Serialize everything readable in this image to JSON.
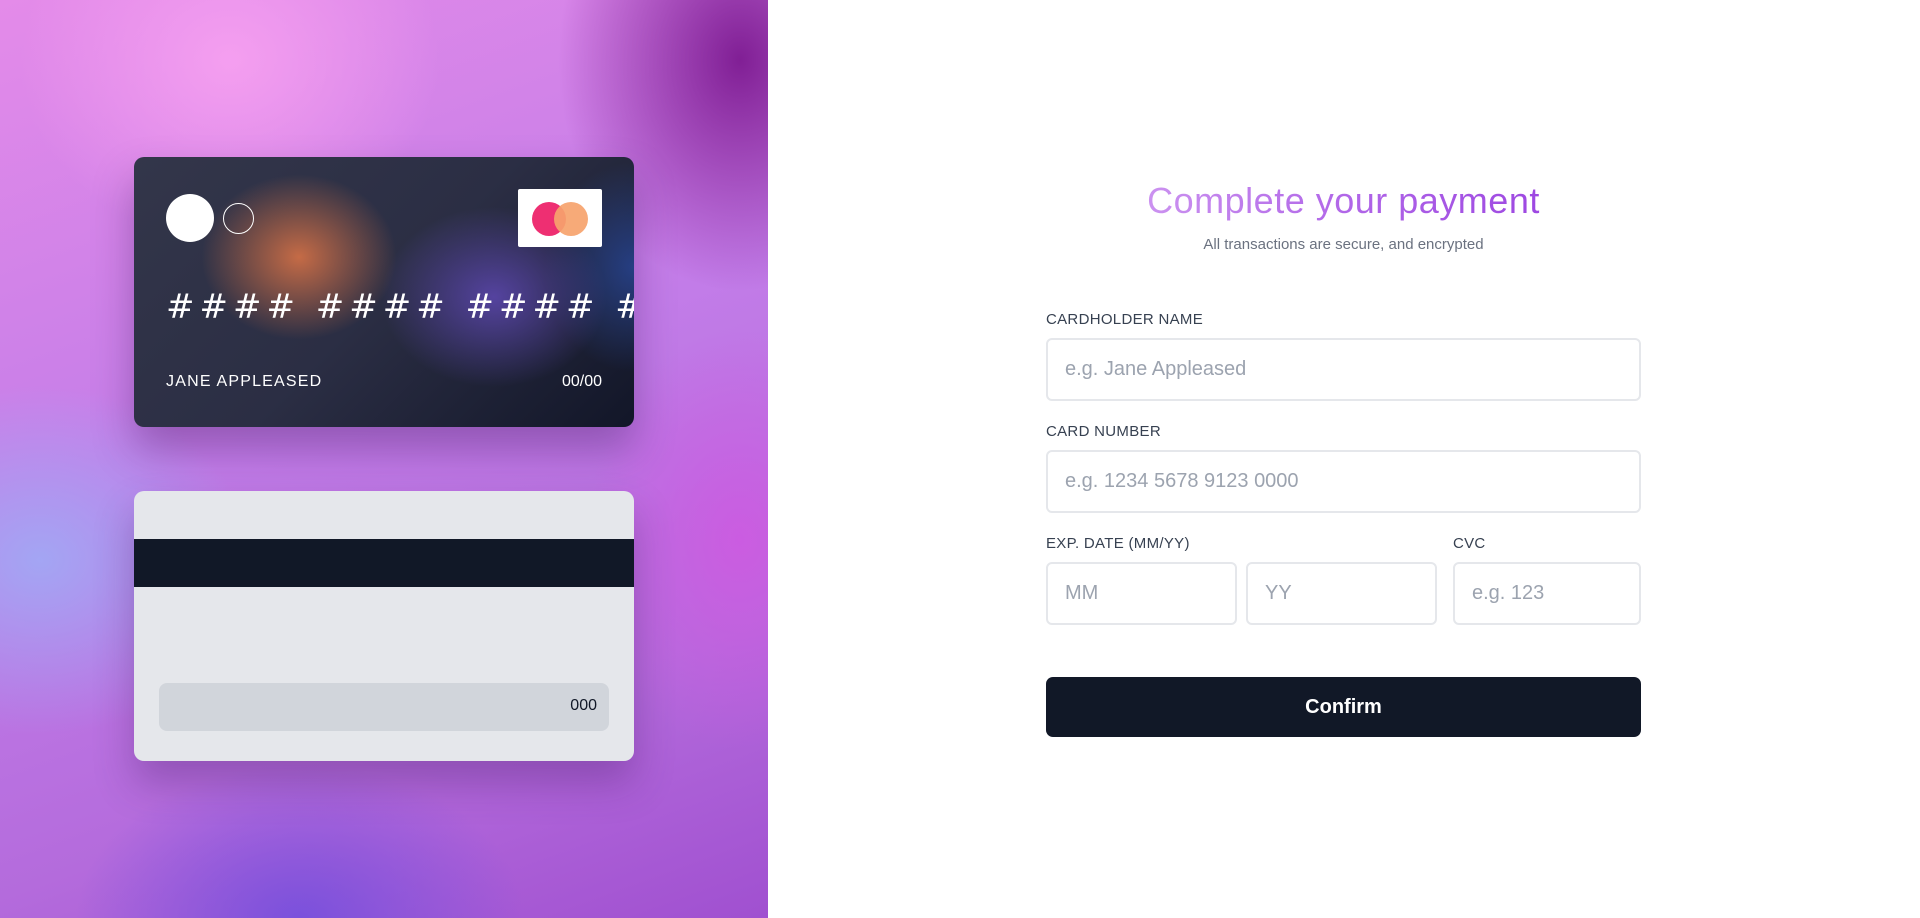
{
  "colors": {
    "accent_title_start": "#d9a8f4",
    "accent_title_end": "#9338de",
    "button_bg": "#111827",
    "card_back_bg": "#e5e7eb",
    "mastercard_red": "#ee2f72",
    "mastercard_orange": "#f6a36d"
  },
  "card_front": {
    "number": "#### #### #### ####",
    "holder": "JANE APPLEASED",
    "expiry": "00/00",
    "brand_icon": "mastercard-logo-icon"
  },
  "card_back": {
    "cvc": "000"
  },
  "form": {
    "title": "Complete your payment",
    "subtitle": "All transactions are secure, and encrypted",
    "cardholder": {
      "label": "CARDHOLDER NAME",
      "value": "",
      "placeholder": "e.g. Jane Appleased"
    },
    "card_number": {
      "label": "CARD NUMBER",
      "value": "",
      "placeholder": "e.g. 1234 5678 9123 0000"
    },
    "expiry": {
      "label": "EXP. DATE (MM/YY)",
      "month_placeholder": "MM",
      "year_placeholder": "YY",
      "month_value": "",
      "year_value": ""
    },
    "cvc": {
      "label": "CVC",
      "value": "",
      "placeholder": "e.g. 123"
    },
    "confirm_label": "Confirm"
  }
}
